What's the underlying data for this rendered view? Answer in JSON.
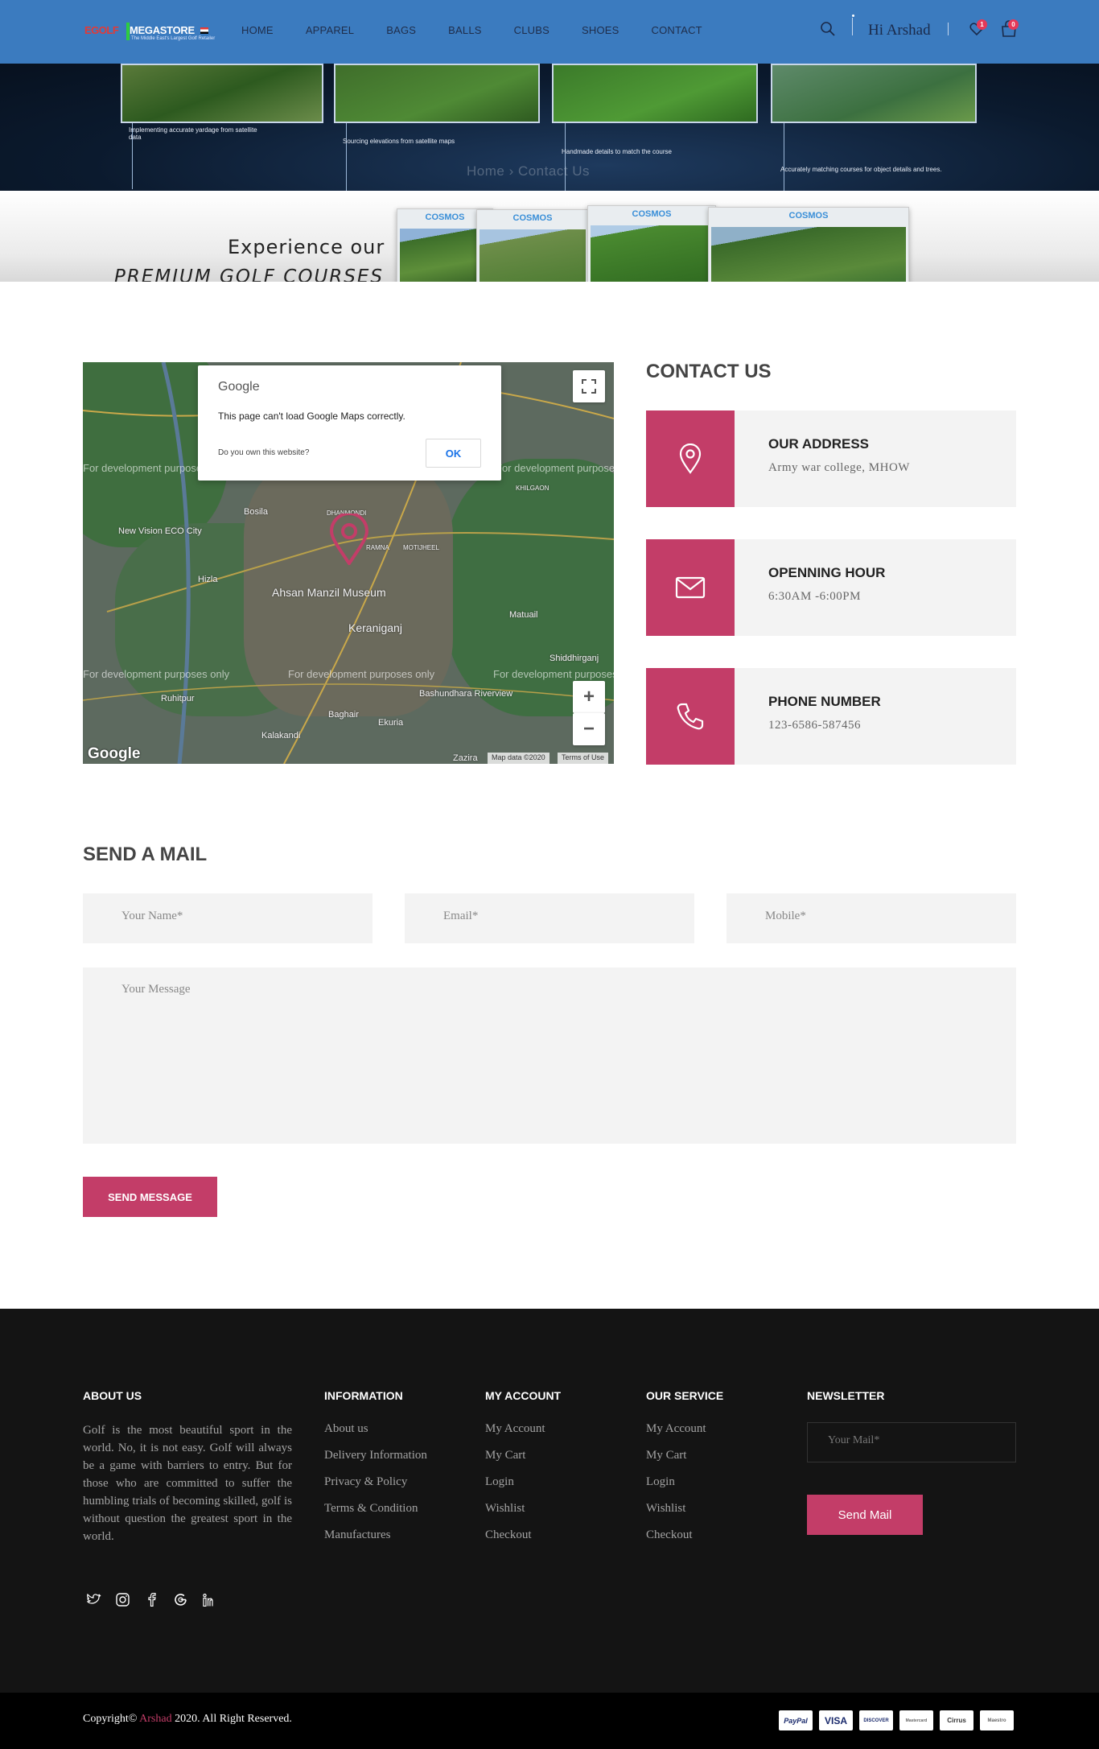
{
  "header": {
    "logo": {
      "part1": "EGOLF",
      "part2": "MEGASTORE",
      "tagline": "The Middle East's Largest Golf Retailer"
    },
    "nav": [
      "HOME",
      "APPAREL",
      "BAGS",
      "BALLS",
      "CLUBS",
      "SHOES",
      "CONTACT"
    ],
    "greeting": "Hi Arshad",
    "wishlist_count": "1",
    "cart_count": "0"
  },
  "banner": {
    "captions": [
      "Implementing accurate yardage from satellite data",
      "Sourcing elevations from satellite maps",
      "Handmade details to match the course",
      "Accurately matching courses for object details and trees."
    ],
    "breadcrumb": "Home  ›  Contact Us"
  },
  "ad": {
    "line1": "Experience our",
    "line2": "PREMIUM GOLF COURSES",
    "card_label": "COSMOS"
  },
  "map": {
    "dialog_logo": "Google",
    "dialog_message": "This page can't load Google Maps correctly.",
    "dialog_question": "Do you own this website?",
    "dialog_ok": "OK",
    "dev_watermark": "For development purposes only",
    "labels": [
      "Bosila",
      "Ahsan Manzil Museum",
      "Keraniganj",
      "Hizla",
      "New Vision ECO City",
      "Matuail",
      "Shiddhirganj",
      "Ruhitpur",
      "Bashundhara Riverview",
      "Baghair",
      "Kalakandi",
      "Ekuria",
      "Zazira",
      "DHANMONDI",
      "RAMNA",
      "MOTIJHEEL",
      "KHILGAON"
    ],
    "google_mark": "Google",
    "map_data": "Map data ©2020",
    "terms": "Terms of Use"
  },
  "contact": {
    "heading": "CONTACT US",
    "items": [
      {
        "title": "OUR ADDRESS",
        "value": "Army war college, MHOW"
      },
      {
        "title": "OPENNING HOUR",
        "value": "6:30AM -6:00PM"
      },
      {
        "title": "PHONE NUMBER",
        "value": "123-6586-587456"
      }
    ]
  },
  "mail": {
    "heading": "SEND A MAIL",
    "name_placeholder": "Your Name*",
    "email_placeholder": "Email*",
    "mobile_placeholder": "Mobile*",
    "message_placeholder": "Your Message",
    "send_label": "SEND MESSAGE"
  },
  "footer": {
    "about_heading": "ABOUT US",
    "about_text": "Golf is the most beautiful sport in the world. No, it is not easy. Golf will always be a game with barriers to entry. But for those who are committed to suffer the humbling trials of becoming skilled, golf is without question the greatest sport in the world.",
    "info_heading": "INFORMATION",
    "info_links": [
      "About us",
      "Delivery Information",
      "Privacy & Policy",
      "Terms & Condition",
      "Manufactures"
    ],
    "account_heading": "MY ACCOUNT",
    "account_links": [
      "My Account",
      "My Cart",
      "Login",
      "Wishlist",
      "Checkout"
    ],
    "service_heading": "OUR SERVICE",
    "service_links": [
      "My Account",
      "My Cart",
      "Login",
      "Wishlist",
      "Checkout"
    ],
    "newsletter_heading": "NEWSLETTER",
    "newsletter_placeholder": "Your Mail*",
    "newsletter_button": "Send Mail",
    "social": [
      "twitter-icon",
      "instagram-icon",
      "facebook-icon",
      "google-icon",
      "linkedin-icon"
    ]
  },
  "copyright": {
    "prefix": "Copyright© ",
    "brand": "Arshad",
    "suffix": " 2020. All Right Reserved.",
    "payments": [
      "PayPal",
      "VISA",
      "DISCOVER",
      "Mastercard",
      "Cirrus",
      "Maestro"
    ]
  },
  "colors": {
    "header_bg": "#3b7bbf",
    "accent": "#c33d68",
    "footer_bg": "#141414"
  }
}
